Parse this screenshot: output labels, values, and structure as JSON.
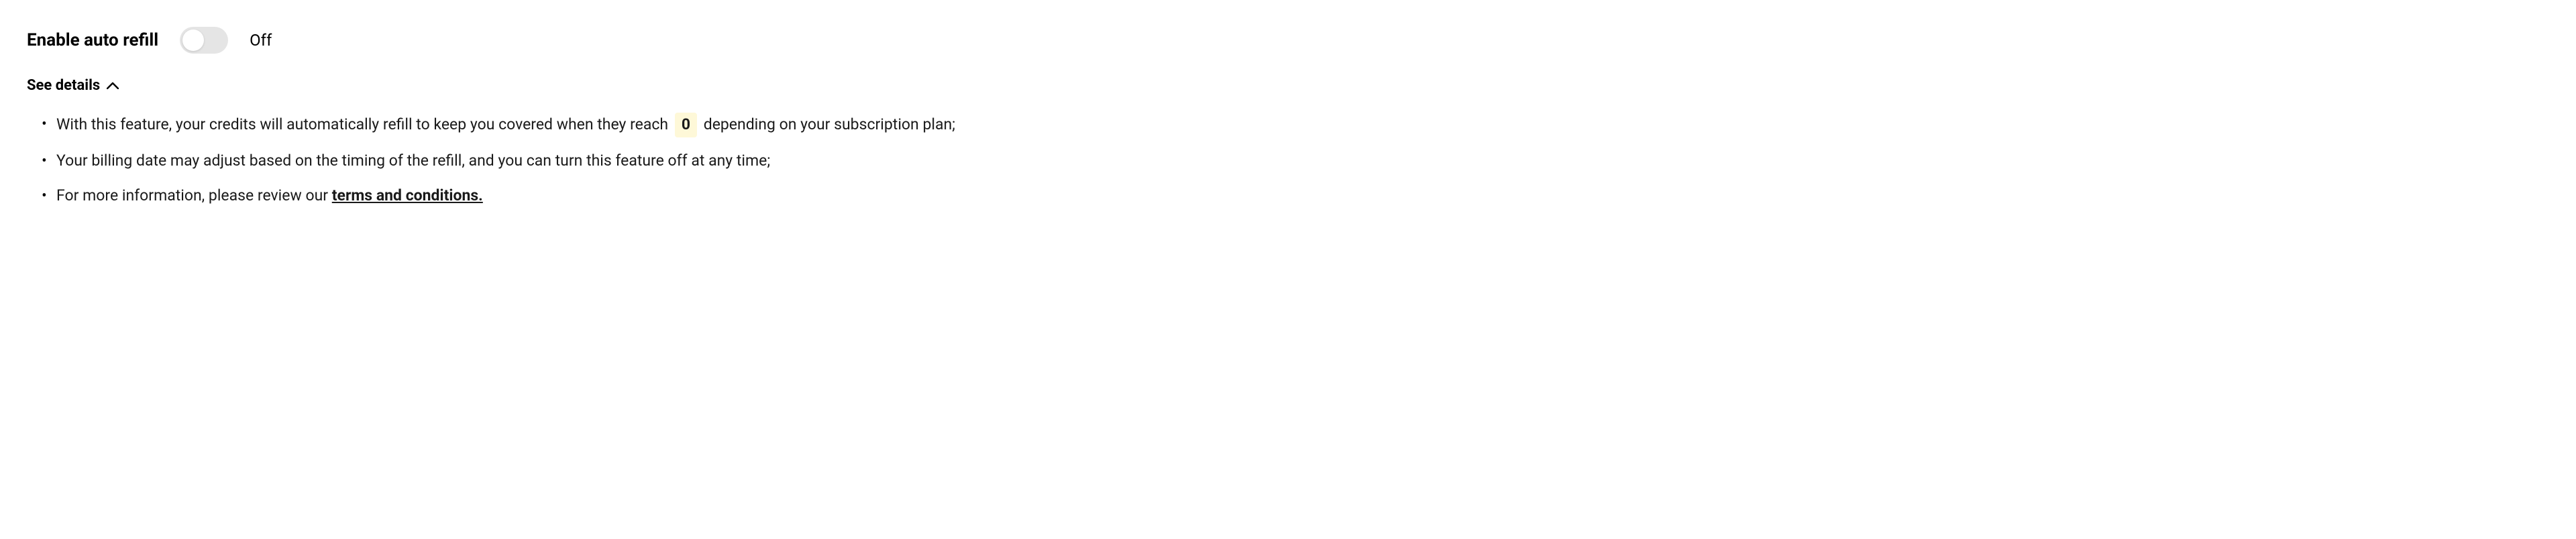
{
  "header": {
    "title": "Enable auto refill",
    "toggle_state": "Off"
  },
  "details": {
    "toggle_label": "See details",
    "bullet1_prefix": "With this feature, your credits will automatically refill to keep you covered when they reach ",
    "bullet1_badge": "0",
    "bullet1_suffix": " depending on your subscription plan;",
    "bullet2": "Your billing date may adjust based on the timing of the refill, and you can turn this feature off at any time;",
    "bullet3_prefix": "For more information, please review our ",
    "bullet3_link": "terms and conditions."
  }
}
